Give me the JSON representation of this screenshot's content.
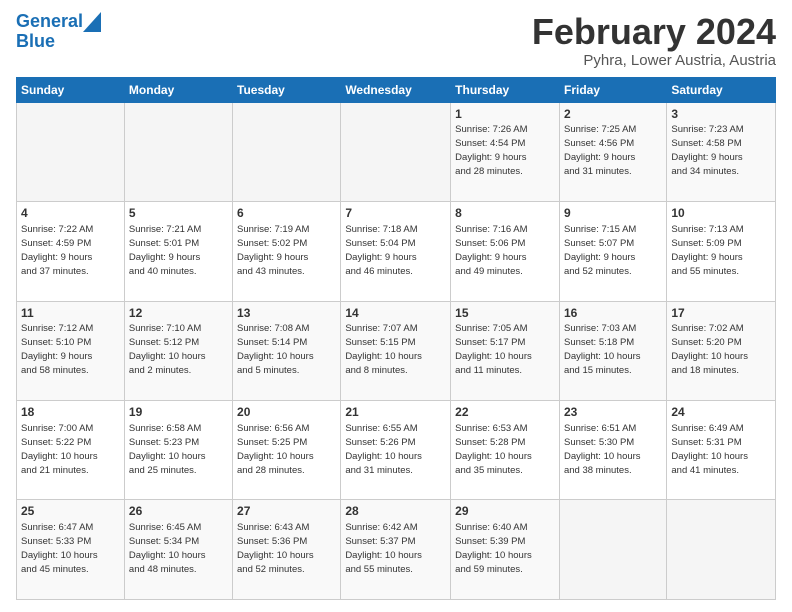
{
  "logo": {
    "line1": "General",
    "line2": "Blue"
  },
  "title": "February 2024",
  "subtitle": "Pyhra, Lower Austria, Austria",
  "days_header": [
    "Sunday",
    "Monday",
    "Tuesday",
    "Wednesday",
    "Thursday",
    "Friday",
    "Saturday"
  ],
  "weeks": [
    [
      {
        "num": "",
        "detail": ""
      },
      {
        "num": "",
        "detail": ""
      },
      {
        "num": "",
        "detail": ""
      },
      {
        "num": "",
        "detail": ""
      },
      {
        "num": "1",
        "detail": "Sunrise: 7:26 AM\nSunset: 4:54 PM\nDaylight: 9 hours\nand 28 minutes."
      },
      {
        "num": "2",
        "detail": "Sunrise: 7:25 AM\nSunset: 4:56 PM\nDaylight: 9 hours\nand 31 minutes."
      },
      {
        "num": "3",
        "detail": "Sunrise: 7:23 AM\nSunset: 4:58 PM\nDaylight: 9 hours\nand 34 minutes."
      }
    ],
    [
      {
        "num": "4",
        "detail": "Sunrise: 7:22 AM\nSunset: 4:59 PM\nDaylight: 9 hours\nand 37 minutes."
      },
      {
        "num": "5",
        "detail": "Sunrise: 7:21 AM\nSunset: 5:01 PM\nDaylight: 9 hours\nand 40 minutes."
      },
      {
        "num": "6",
        "detail": "Sunrise: 7:19 AM\nSunset: 5:02 PM\nDaylight: 9 hours\nand 43 minutes."
      },
      {
        "num": "7",
        "detail": "Sunrise: 7:18 AM\nSunset: 5:04 PM\nDaylight: 9 hours\nand 46 minutes."
      },
      {
        "num": "8",
        "detail": "Sunrise: 7:16 AM\nSunset: 5:06 PM\nDaylight: 9 hours\nand 49 minutes."
      },
      {
        "num": "9",
        "detail": "Sunrise: 7:15 AM\nSunset: 5:07 PM\nDaylight: 9 hours\nand 52 minutes."
      },
      {
        "num": "10",
        "detail": "Sunrise: 7:13 AM\nSunset: 5:09 PM\nDaylight: 9 hours\nand 55 minutes."
      }
    ],
    [
      {
        "num": "11",
        "detail": "Sunrise: 7:12 AM\nSunset: 5:10 PM\nDaylight: 9 hours\nand 58 minutes."
      },
      {
        "num": "12",
        "detail": "Sunrise: 7:10 AM\nSunset: 5:12 PM\nDaylight: 10 hours\nand 2 minutes."
      },
      {
        "num": "13",
        "detail": "Sunrise: 7:08 AM\nSunset: 5:14 PM\nDaylight: 10 hours\nand 5 minutes."
      },
      {
        "num": "14",
        "detail": "Sunrise: 7:07 AM\nSunset: 5:15 PM\nDaylight: 10 hours\nand 8 minutes."
      },
      {
        "num": "15",
        "detail": "Sunrise: 7:05 AM\nSunset: 5:17 PM\nDaylight: 10 hours\nand 11 minutes."
      },
      {
        "num": "16",
        "detail": "Sunrise: 7:03 AM\nSunset: 5:18 PM\nDaylight: 10 hours\nand 15 minutes."
      },
      {
        "num": "17",
        "detail": "Sunrise: 7:02 AM\nSunset: 5:20 PM\nDaylight: 10 hours\nand 18 minutes."
      }
    ],
    [
      {
        "num": "18",
        "detail": "Sunrise: 7:00 AM\nSunset: 5:22 PM\nDaylight: 10 hours\nand 21 minutes."
      },
      {
        "num": "19",
        "detail": "Sunrise: 6:58 AM\nSunset: 5:23 PM\nDaylight: 10 hours\nand 25 minutes."
      },
      {
        "num": "20",
        "detail": "Sunrise: 6:56 AM\nSunset: 5:25 PM\nDaylight: 10 hours\nand 28 minutes."
      },
      {
        "num": "21",
        "detail": "Sunrise: 6:55 AM\nSunset: 5:26 PM\nDaylight: 10 hours\nand 31 minutes."
      },
      {
        "num": "22",
        "detail": "Sunrise: 6:53 AM\nSunset: 5:28 PM\nDaylight: 10 hours\nand 35 minutes."
      },
      {
        "num": "23",
        "detail": "Sunrise: 6:51 AM\nSunset: 5:30 PM\nDaylight: 10 hours\nand 38 minutes."
      },
      {
        "num": "24",
        "detail": "Sunrise: 6:49 AM\nSunset: 5:31 PM\nDaylight: 10 hours\nand 41 minutes."
      }
    ],
    [
      {
        "num": "25",
        "detail": "Sunrise: 6:47 AM\nSunset: 5:33 PM\nDaylight: 10 hours\nand 45 minutes."
      },
      {
        "num": "26",
        "detail": "Sunrise: 6:45 AM\nSunset: 5:34 PM\nDaylight: 10 hours\nand 48 minutes."
      },
      {
        "num": "27",
        "detail": "Sunrise: 6:43 AM\nSunset: 5:36 PM\nDaylight: 10 hours\nand 52 minutes."
      },
      {
        "num": "28",
        "detail": "Sunrise: 6:42 AM\nSunset: 5:37 PM\nDaylight: 10 hours\nand 55 minutes."
      },
      {
        "num": "29",
        "detail": "Sunrise: 6:40 AM\nSunset: 5:39 PM\nDaylight: 10 hours\nand 59 minutes."
      },
      {
        "num": "",
        "detail": ""
      },
      {
        "num": "",
        "detail": ""
      }
    ]
  ]
}
